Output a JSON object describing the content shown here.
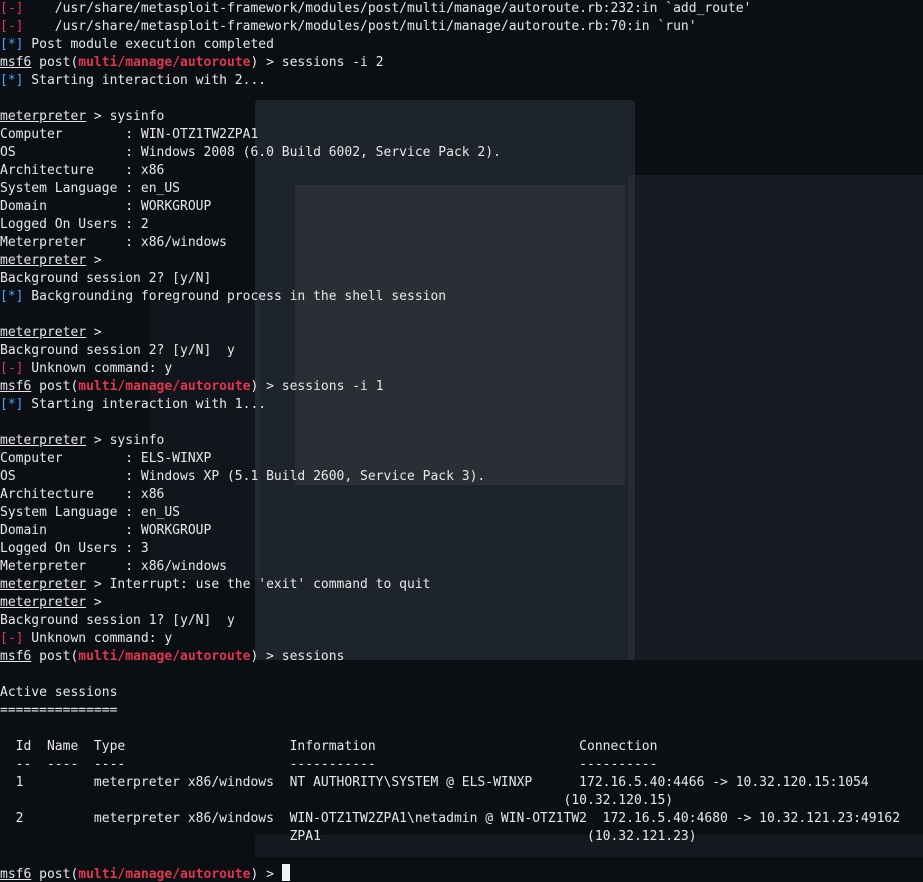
{
  "colors": {
    "background": "#0b0f14",
    "text": "#e8e8e8",
    "error_tag": "#e0364f",
    "info_tag": "#4aa3ff",
    "module_name": "#e0364f"
  },
  "lines": [
    {
      "type": "err",
      "text": "    /usr/share/metasploit-framework/modules/post/multi/manage/autoroute.rb:232:in `add_route'"
    },
    {
      "type": "err",
      "text": "    /usr/share/metasploit-framework/modules/post/multi/manage/autoroute.rb:70:in `run'"
    },
    {
      "type": "info",
      "text": " Post module execution completed"
    },
    {
      "type": "msf",
      "text": " > sessions -i 2"
    },
    {
      "type": "info",
      "text": " Starting interaction with 2..."
    },
    {
      "type": "blank",
      "text": ""
    },
    {
      "type": "met",
      "text": " > sysinfo"
    },
    {
      "type": "plain",
      "text": "Computer        : WIN-OTZ1TW2ZPA1"
    },
    {
      "type": "plain",
      "text": "OS              : Windows 2008 (6.0 Build 6002, Service Pack 2)."
    },
    {
      "type": "plain",
      "text": "Architecture    : x86"
    },
    {
      "type": "plain",
      "text": "System Language : en_US"
    },
    {
      "type": "plain",
      "text": "Domain          : WORKGROUP"
    },
    {
      "type": "plain",
      "text": "Logged On Users : 2"
    },
    {
      "type": "plain",
      "text": "Meterpreter     : x86/windows"
    },
    {
      "type": "met",
      "text": " >"
    },
    {
      "type": "plain",
      "text": "Background session 2? [y/N]"
    },
    {
      "type": "info",
      "text": " Backgrounding foreground process in the shell session"
    },
    {
      "type": "blank",
      "text": ""
    },
    {
      "type": "met",
      "text": " >"
    },
    {
      "type": "plain",
      "text": "Background session 2? [y/N]  y"
    },
    {
      "type": "err",
      "text": " Unknown command: y"
    },
    {
      "type": "msf",
      "text": " > sessions -i 1"
    },
    {
      "type": "info",
      "text": " Starting interaction with 1..."
    },
    {
      "type": "blank",
      "text": ""
    },
    {
      "type": "met",
      "text": " > sysinfo"
    },
    {
      "type": "plain",
      "text": "Computer        : ELS-WINXP"
    },
    {
      "type": "plain",
      "text": "OS              : Windows XP (5.1 Build 2600, Service Pack 3)."
    },
    {
      "type": "plain",
      "text": "Architecture    : x86"
    },
    {
      "type": "plain",
      "text": "System Language : en_US"
    },
    {
      "type": "plain",
      "text": "Domain          : WORKGROUP"
    },
    {
      "type": "plain",
      "text": "Logged On Users : 3"
    },
    {
      "type": "plain",
      "text": "Meterpreter     : x86/windows"
    },
    {
      "type": "met",
      "text": " > Interrupt: use the 'exit' command to quit"
    },
    {
      "type": "met",
      "text": " >"
    },
    {
      "type": "plain",
      "text": "Background session 1? [y/N]  y"
    },
    {
      "type": "err",
      "text": " Unknown command: y"
    },
    {
      "type": "msf",
      "text": " > sessions"
    },
    {
      "type": "blank",
      "text": ""
    },
    {
      "type": "plain",
      "text": "Active sessions"
    },
    {
      "type": "plain",
      "text": "==============="
    },
    {
      "type": "blank",
      "text": ""
    },
    {
      "type": "plain",
      "text": "  Id  Name  Type                     Information                          Connection"
    },
    {
      "type": "plain",
      "text": "  --  ----  ----                     -----------                          ----------"
    },
    {
      "type": "plain",
      "text": "  1         meterpreter x86/windows  NT AUTHORITY\\SYSTEM @ ELS-WINXP      172.16.5.40:4466 -> 10.32.120.15:1054"
    },
    {
      "type": "plain",
      "text": "                                                                        (10.32.120.15)"
    },
    {
      "type": "plain",
      "text": "  2         meterpreter x86/windows  WIN-OTZ1TW2ZPA1\\netadmin @ WIN-OTZ1TW2  172.16.5.40:4680 -> 10.32.121.23:49162"
    },
    {
      "type": "plain",
      "text": "                                     ZPA1                                  (10.32.121.23)"
    },
    {
      "type": "blank",
      "text": ""
    },
    {
      "type": "msf",
      "text": " > ",
      "cursor": true
    }
  ],
  "tags": {
    "err": "[-]",
    "info": "[*]",
    "msf_prefix": "msf6",
    "msf_post": " post(",
    "msf_module": "multi/manage/autoroute",
    "msf_close": ")",
    "met_prompt": "meterpreter"
  }
}
